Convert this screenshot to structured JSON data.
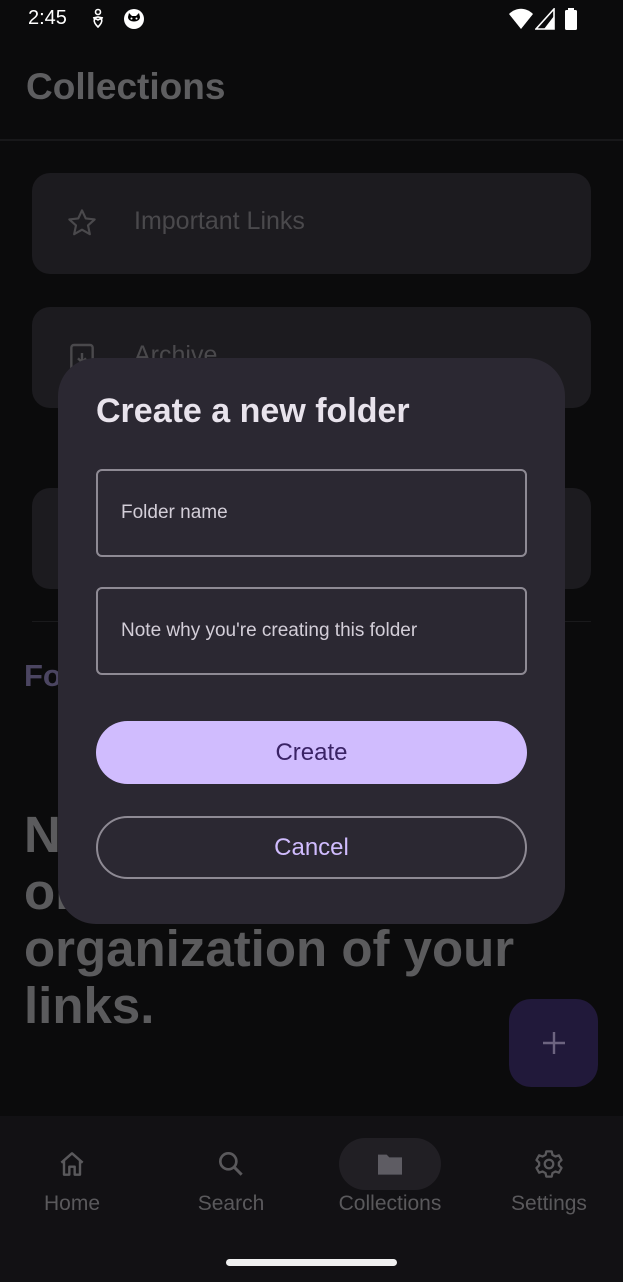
{
  "status_bar": {
    "time": "2:45",
    "icons": [
      "accessibility-icon",
      "cat-face-icon",
      "wifi-icon",
      "signal-icon",
      "battery-icon"
    ]
  },
  "header": {
    "title": "Collections"
  },
  "collections": [
    {
      "label": "Important Links",
      "icon": "star-icon"
    },
    {
      "label": "Archive",
      "icon": "archive-icon"
    },
    {
      "label": "",
      "icon": ""
    }
  ],
  "folders_section": {
    "title": "Folders"
  },
  "empty_state": {
    "text": "No Folders. Create one for better organization of your links."
  },
  "fab": {
    "icon": "plus-icon"
  },
  "dialog": {
    "title": "Create a new folder",
    "folder_name": {
      "value": "",
      "placeholder": "Folder name"
    },
    "note": {
      "value": "",
      "placeholder": "Note why you're creating this folder"
    },
    "create_label": "Create",
    "cancel_label": "Cancel"
  },
  "bottom_nav": {
    "items": [
      {
        "label": "Home",
        "icon": "home-icon",
        "active": false
      },
      {
        "label": "Search",
        "icon": "search-icon",
        "active": false
      },
      {
        "label": "Collections",
        "icon": "folder-icon",
        "active": true
      },
      {
        "label": "Settings",
        "icon": "gear-icon",
        "active": false
      }
    ]
  },
  "colors": {
    "accent": "#d0bcfe",
    "dialog_bg": "#2b2832",
    "background": "#0b0b0c"
  }
}
